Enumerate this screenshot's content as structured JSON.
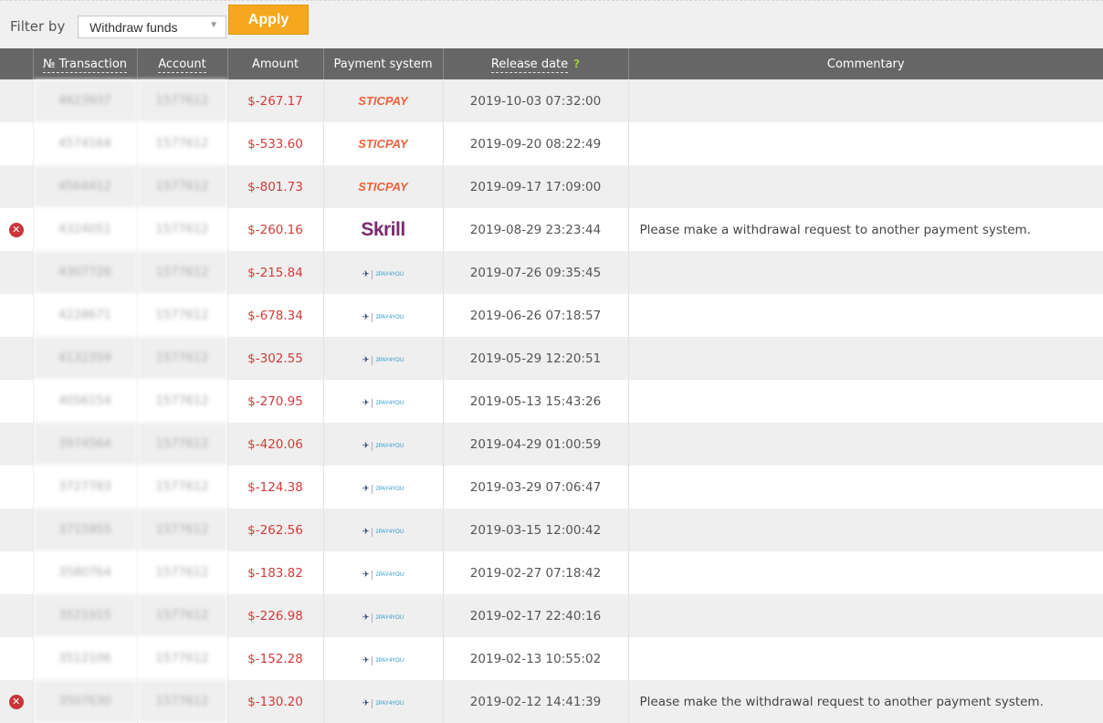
{
  "filter": {
    "label": "Filter by",
    "selected": "Withdraw funds",
    "apply_label": "Apply"
  },
  "table": {
    "columns": {
      "transaction": "№ Transaction",
      "account": "Account",
      "amount": "Amount",
      "payment_system": "Payment system",
      "release_date": "Release date",
      "release_help": "?",
      "commentary": "Commentary"
    },
    "rows": [
      {
        "status": "",
        "transaction": "4623937",
        "account": "1577612",
        "amount": "$-267.17",
        "payment": "STICPAY",
        "date": "2019-10-03 07:32:00",
        "comment": ""
      },
      {
        "status": "",
        "transaction": "4574164",
        "account": "1577612",
        "amount": "$-533.60",
        "payment": "STICPAY",
        "date": "2019-09-20 08:22:49",
        "comment": ""
      },
      {
        "status": "",
        "transaction": "4564412",
        "account": "1577612",
        "amount": "$-801.73",
        "payment": "STICPAY",
        "date": "2019-09-17 17:09:00",
        "comment": ""
      },
      {
        "status": "x",
        "transaction": "4324051",
        "account": "1577612",
        "amount": "$-260.16",
        "payment": "Skrill",
        "date": "2019-08-29 23:23:44",
        "comment": "Please make a withdrawal request to another payment system."
      },
      {
        "status": "",
        "transaction": "4307726",
        "account": "1577612",
        "amount": "$-215.84",
        "payment": "2PAY4YOU",
        "date": "2019-07-26 09:35:45",
        "comment": ""
      },
      {
        "status": "",
        "transaction": "4228671",
        "account": "1577612",
        "amount": "$-678.34",
        "payment": "2PAY4YOU",
        "date": "2019-06-26 07:18:57",
        "comment": ""
      },
      {
        "status": "",
        "transaction": "4132359",
        "account": "1577612",
        "amount": "$-302.55",
        "payment": "2PAY4YOU",
        "date": "2019-05-29 12:20:51",
        "comment": ""
      },
      {
        "status": "",
        "transaction": "4056154",
        "account": "1577612",
        "amount": "$-270.95",
        "payment": "2PAY4YOU",
        "date": "2019-05-13 15:43:26",
        "comment": ""
      },
      {
        "status": "",
        "transaction": "3974564",
        "account": "1577612",
        "amount": "$-420.06",
        "payment": "2PAY4YOU",
        "date": "2019-04-29 01:00:59",
        "comment": ""
      },
      {
        "status": "",
        "transaction": "3727783",
        "account": "1577612",
        "amount": "$-124.38",
        "payment": "2PAY4YOU",
        "date": "2019-03-29 07:06:47",
        "comment": ""
      },
      {
        "status": "",
        "transaction": "3715955",
        "account": "1577612",
        "amount": "$-262.56",
        "payment": "2PAY4YOU",
        "date": "2019-03-15 12:00:42",
        "comment": ""
      },
      {
        "status": "",
        "transaction": "3580764",
        "account": "1577612",
        "amount": "$-183.82",
        "payment": "2PAY4YOU",
        "date": "2019-02-27 07:18:42",
        "comment": ""
      },
      {
        "status": "",
        "transaction": "3521915",
        "account": "1577612",
        "amount": "$-226.98",
        "payment": "2PAY4YOU",
        "date": "2019-02-17 22:40:16",
        "comment": ""
      },
      {
        "status": "",
        "transaction": "3512106",
        "account": "1577612",
        "amount": "$-152.28",
        "payment": "2PAY4YOU",
        "date": "2019-02-13 10:55:02",
        "comment": ""
      },
      {
        "status": "x",
        "transaction": "3507630",
        "account": "1577612",
        "amount": "$-130.20",
        "payment": "2PAY4YOU",
        "date": "2019-02-12 14:41:39",
        "comment": "Please make the withdrawal request to another payment system."
      }
    ]
  },
  "colors": {
    "header_bg": "#666666",
    "amount": "#d23b3b",
    "apply_bg": "#f5a81d",
    "status_error": "#c9353b"
  }
}
